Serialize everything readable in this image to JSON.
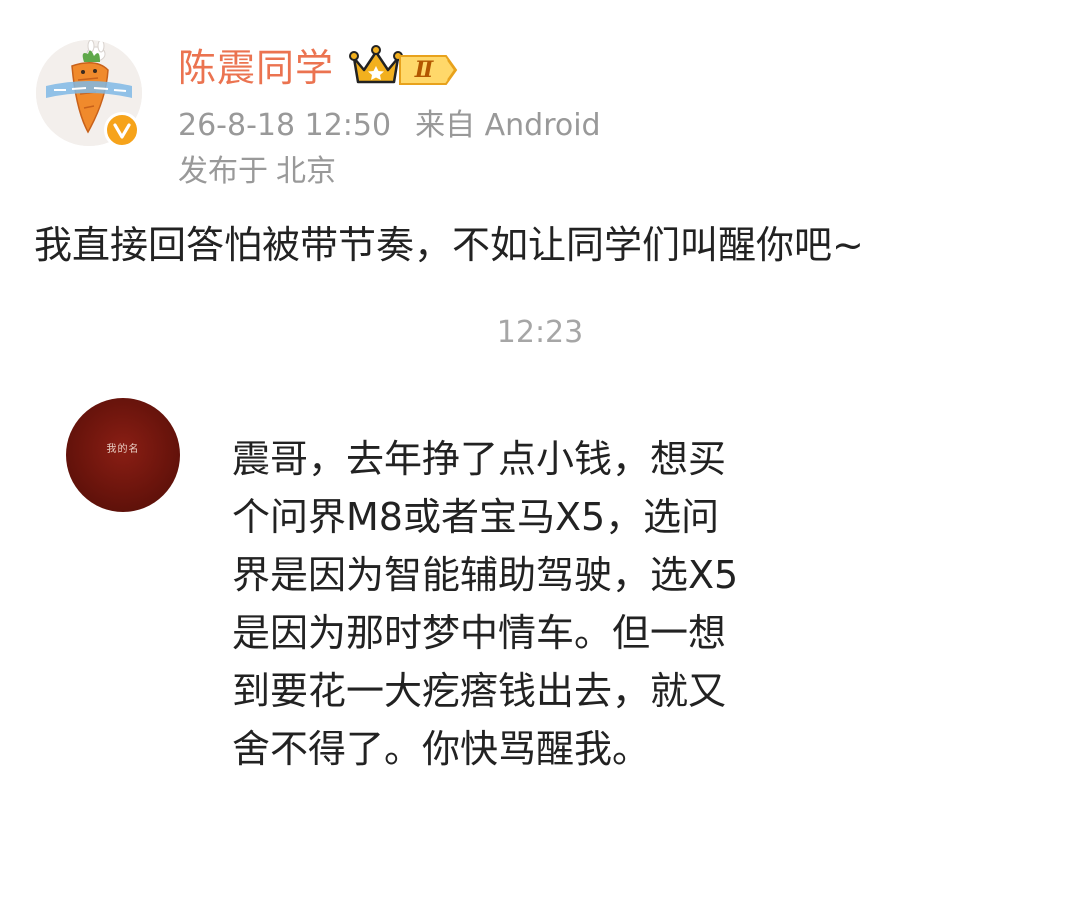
{
  "post": {
    "author": {
      "name": "陈震同学",
      "level_badge": "Ⅱ",
      "avatar_icon": "carrot-avatar-icon",
      "verified_icon": "verified-v-icon",
      "crown_icon": "crown-icon"
    },
    "meta": {
      "time": "26-8-18 12:50",
      "source": "来自 Android",
      "location_prefix": "发布于",
      "location": "北京"
    },
    "text": "我直接回答怕被带节奏，不如让同学们叫醒你吧~"
  },
  "chat": {
    "time": "12:23",
    "sender_avatar_text": "我的名",
    "message_lines": [
      "震哥，去年挣了点小钱，想买",
      "个问界M8或者宝马X5，选问",
      "界是因为智能辅助驾驶，选X5",
      "是因为那时梦中情车。但一想",
      "到要花一大疙瘩钱出去，就又",
      "舍不得了。你快骂醒我。"
    ]
  },
  "colors": {
    "username": "#eb7350",
    "meta": "#999999",
    "body_text": "#222222",
    "verified_badge": "#f6a31a",
    "crown": "#f2b01e",
    "sender_avatar": "#7a180f"
  }
}
